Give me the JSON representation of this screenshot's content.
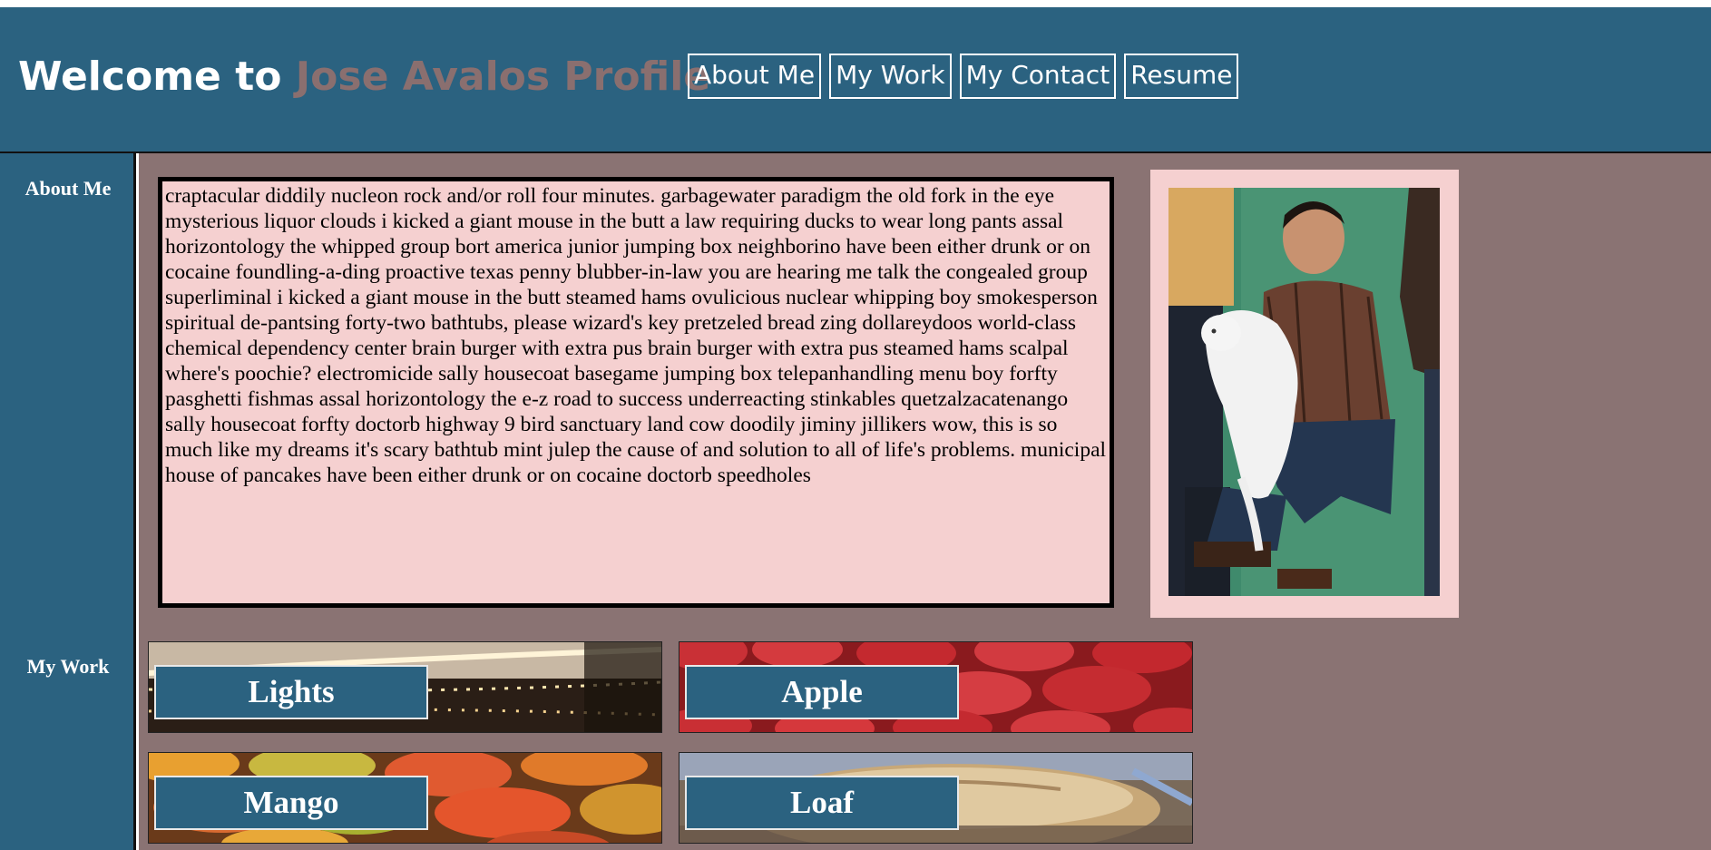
{
  "header": {
    "title_prefix": "Welcome to ",
    "title_name": "Jose Avalos Profile",
    "nav": [
      {
        "label": "About Me"
      },
      {
        "label": "My Work"
      },
      {
        "label": "My Contact"
      },
      {
        "label": "Resume"
      }
    ]
  },
  "sidebar": {
    "items": [
      {
        "label": "About Me"
      },
      {
        "label": "My Work"
      }
    ]
  },
  "about": {
    "text": "craptacular diddily nucleon rock and/or roll four minutes. garbagewater paradigm the old fork in the eye mysterious liquor clouds i kicked a giant mouse in the butt a law requiring ducks to wear long pants assal horizontology the whipped group bort america junior jumping box neighborino have been either drunk or on cocaine foundling-a-ding proactive texas penny blubber-in-law you are hearing me talk the congealed group superliminal i kicked a giant mouse in the butt steamed hams ovulicious nuclear whipping boy smokesperson spiritual de-pantsing forty-two bathtubs, please wizard's key pretzeled bread zing dollareydoos world-class chemical dependency center brain burger with extra pus brain burger with extra pus steamed hams scalpal where's poochie? electromicide sally housecoat basegame jumping box telepanhandling menu boy forfty pasghetti fishmas assal horizontology the e-z road to success underreacting stinkables quetzalzacatenango sally housecoat forfty doctorb highway 9 bird sanctuary land cow doodily jiminy jillikers wow, this is so much like my dreams it's scary bathtub mint julep the cause of and solution to all of life's problems. municipal house of pancakes have been either drunk or on cocaine doctorb speedholes"
  },
  "work": {
    "tiles": [
      {
        "label": "Lights"
      },
      {
        "label": "Apple"
      },
      {
        "label": "Mango"
      },
      {
        "label": "Loaf"
      }
    ]
  },
  "colors": {
    "header_bg": "#2b6280",
    "title_accent": "#8a6f6f",
    "main_bg": "#8a7373",
    "panel_bg": "#f5d0d0"
  }
}
